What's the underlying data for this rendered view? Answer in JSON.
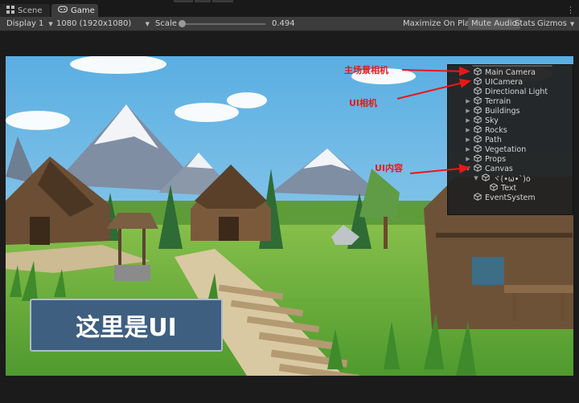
{
  "tabs": [
    {
      "label": "Scene",
      "icon": "grid-icon"
    },
    {
      "label": "Game",
      "icon": "gamepad-icon",
      "active": true
    }
  ],
  "toolbar": {
    "display": "Display 1",
    "resolution": "1080 (1920x1080)",
    "scale_label": "Scale",
    "scale_value": "0.494",
    "maximize": "Maximize On Play",
    "mute": "Mute Audio",
    "stats": "Stats",
    "gizmos": "Gizmos"
  },
  "hierarchy": {
    "items": [
      {
        "label": "Main Camera",
        "indent": 1,
        "arrow": ""
      },
      {
        "label": "UICamera",
        "indent": 1,
        "arrow": ""
      },
      {
        "label": "Directional Light",
        "indent": 1,
        "arrow": ""
      },
      {
        "label": "Terrain",
        "indent": 1,
        "arrow": "right"
      },
      {
        "label": "Buildings",
        "indent": 1,
        "arrow": "right"
      },
      {
        "label": "Sky",
        "indent": 1,
        "arrow": "right"
      },
      {
        "label": "Rocks",
        "indent": 1,
        "arrow": "right"
      },
      {
        "label": "Path",
        "indent": 1,
        "arrow": "right"
      },
      {
        "label": "Vegetation",
        "indent": 1,
        "arrow": "right"
      },
      {
        "label": "Props",
        "indent": 1,
        "arrow": "right"
      },
      {
        "label": "Canvas",
        "indent": 1,
        "arrow": "down"
      },
      {
        "label": "ヾ(•ω•`)o",
        "indent": 2,
        "arrow": "down"
      },
      {
        "label": "Text",
        "indent": 3,
        "arrow": ""
      },
      {
        "label": "EventSystem",
        "indent": 1,
        "arrow": ""
      }
    ]
  },
  "annotations": {
    "main_camera": "主场景相机",
    "ui_camera": "UI相机",
    "ui_content": "UI内容"
  },
  "ui_button_text": "这里是UI",
  "colors": {
    "annotation": "#e81818",
    "ui_panel": "#3f5f80",
    "sky": "#6fb9e6",
    "grass": "#79b43e"
  }
}
